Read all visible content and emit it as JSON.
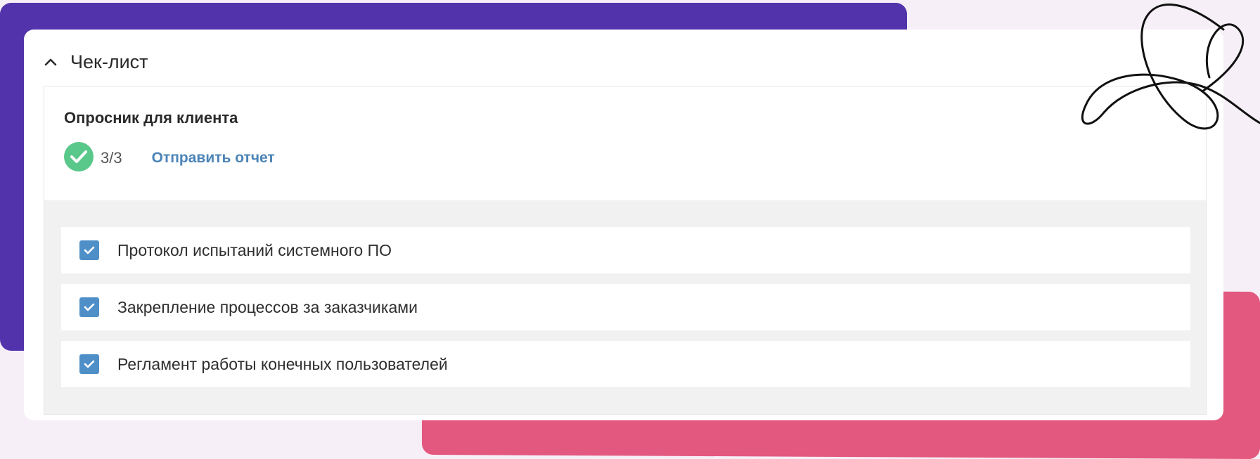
{
  "checklist": {
    "title": "Чек-лист",
    "section_title": "Опросник для клиента",
    "progress": "3/3",
    "send_report_label": "Отправить отчет",
    "items": [
      {
        "label": "Протокол испытаний системного ПО",
        "checked": true
      },
      {
        "label": "Закрепление процессов за заказчиками",
        "checked": true
      },
      {
        "label": "Регламент работы конечных пользователей",
        "checked": true
      }
    ]
  },
  "colors": {
    "purple_shape": "#5233ac",
    "pink_shape": "#e3587e",
    "complete_badge": "#5ac88a",
    "checkbox": "#4f8fc8",
    "link": "#4b84b7"
  },
  "icons": {
    "collapse": "chevron-up-icon",
    "complete": "check-circle-icon",
    "checkbox": "checkmark-icon"
  }
}
